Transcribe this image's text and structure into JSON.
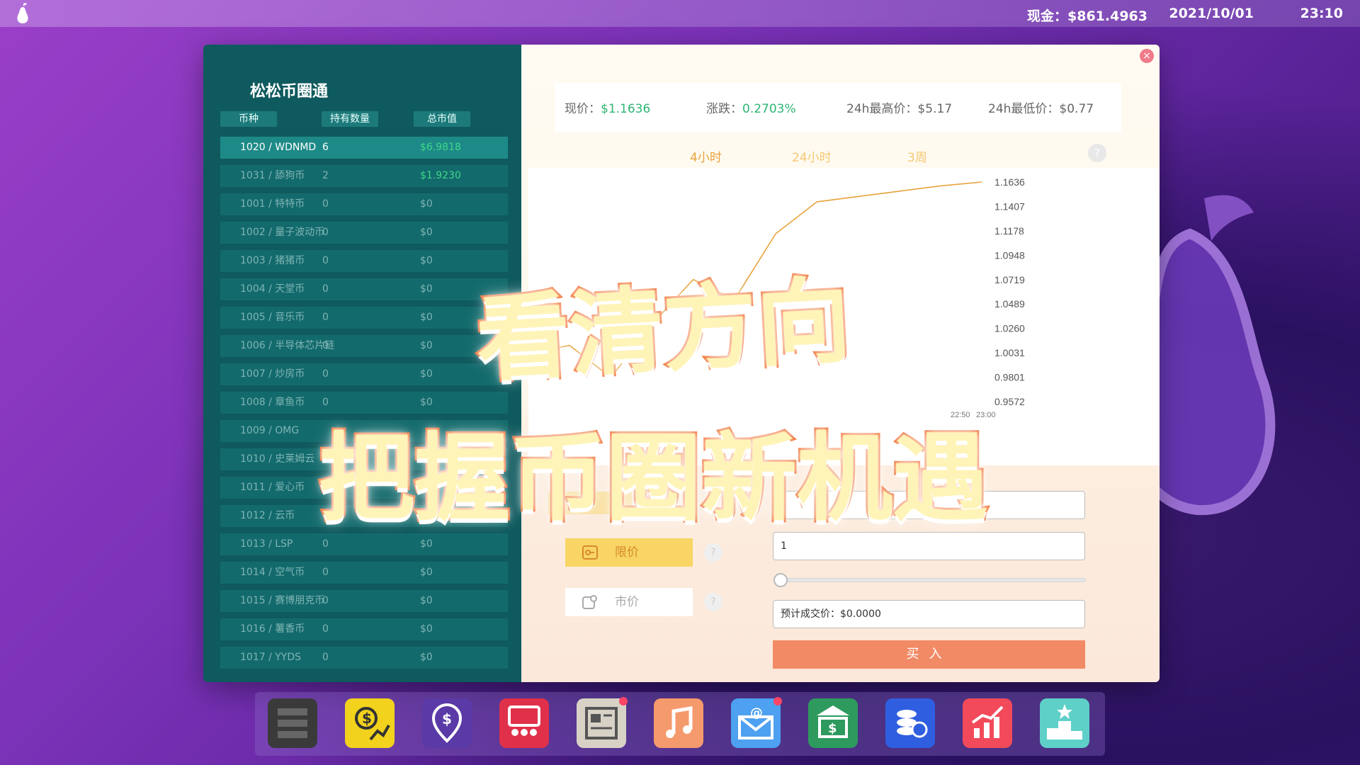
{
  "menubar": {
    "cash": "现金：$861.4963",
    "date": "2021/10/01",
    "time": "23:10"
  },
  "app": {
    "title": "松松币圈通",
    "columns": [
      "币种",
      "持有数量",
      "总市值"
    ],
    "coins": [
      {
        "name": "1020 / WDNMD",
        "qty": "6",
        "value": "$6.9818"
      },
      {
        "name": "1031 / 舔狗币",
        "qty": "2",
        "value": "$1.9230"
      },
      {
        "name": "1001 / 特特币",
        "qty": "0",
        "value": "$0"
      },
      {
        "name": "1002 / 量子波动币",
        "qty": "0",
        "value": "$0"
      },
      {
        "name": "1003 / 猪猪币",
        "qty": "0",
        "value": "$0"
      },
      {
        "name": "1004 / 天堂币",
        "qty": "0",
        "value": "$0"
      },
      {
        "name": "1005 / 音乐币",
        "qty": "0",
        "value": "$0"
      },
      {
        "name": "1006 / 半导体芯片链",
        "qty": "0",
        "value": "$0"
      },
      {
        "name": "1007 / 炒房币",
        "qty": "0",
        "value": "$0"
      },
      {
        "name": "1008 / 章鱼币",
        "qty": "0",
        "value": "$0"
      },
      {
        "name": "1009 / OMG",
        "qty": "",
        "value": ""
      },
      {
        "name": "1010 / 史莱姆云",
        "qty": "",
        "value": ""
      },
      {
        "name": "1011 / 爱心币",
        "qty": "",
        "value": ""
      },
      {
        "name": "1012 / 云币",
        "qty": "0",
        "value": "$0"
      },
      {
        "name": "1013 / LSP",
        "qty": "0",
        "value": "$0"
      },
      {
        "name": "1014 / 空气币",
        "qty": "0",
        "value": "$0"
      },
      {
        "name": "1015 / 赛博朋克币",
        "qty": "0",
        "value": "$0"
      },
      {
        "name": "1016 / 薯香币",
        "qty": "0",
        "value": "$0"
      },
      {
        "name": "1017 / YYDS",
        "qty": "0",
        "value": "$0"
      }
    ],
    "stats": {
      "price_label": "现价：",
      "price_value": "$1.1636",
      "change_label": "涨跌：",
      "change_value": "0.2703%",
      "high_label": "24h最高价：",
      "high_value": "$5.17",
      "low_label": "24h最低价：",
      "low_value": "$0.77"
    },
    "ranges": [
      "4小时",
      "24小时",
      "3周"
    ],
    "help_symbol": "?",
    "close_symbol": "×",
    "buy_tab_label": "入",
    "limit_label": "限价",
    "market_label": "市价",
    "amount_placeholder": "",
    "quantity_value": "1",
    "estimate_value": "预计成交价：$0.0000",
    "buy_label": "买入"
  },
  "chart_data": {
    "type": "line",
    "y_ticks": [
      "1.1636",
      "1.1407",
      "1.1178",
      "1.0948",
      "1.0719",
      "1.0489",
      "1.0260",
      "1.0031",
      "0.9801",
      "0.9572"
    ],
    "x_ticks_visible": [
      "22:50",
      "23:00"
    ],
    "ylim": [
      0.9572,
      1.1636
    ],
    "series": [
      {
        "values": [
          1.003,
          1.01,
          0.98,
          1.03,
          1.072,
          1.053,
          1.115,
          1.145,
          1.15,
          1.155,
          1.16,
          1.1636
        ]
      }
    ],
    "color": "#e8a23a"
  },
  "promo": {
    "line1": "看清方向",
    "line2": "把握币圈新机遇"
  },
  "dock": {
    "icons": [
      {
        "name": "server-icon",
        "color": "#3a3a3a"
      },
      {
        "name": "money-chart-icon",
        "color": "#f2d21c"
      },
      {
        "name": "dollar-pin-icon",
        "color": "#5a3aa6"
      },
      {
        "name": "community-icon",
        "color": "#e0304a"
      },
      {
        "name": "newspaper-icon",
        "color": "#d8d2c6"
      },
      {
        "name": "music-icon",
        "color": "#f59a6c"
      },
      {
        "name": "mail-icon",
        "color": "#4ea0f0"
      },
      {
        "name": "bank-icon",
        "color": "#2e9a5e"
      },
      {
        "name": "coins-icon",
        "color": "#2f5fe0"
      },
      {
        "name": "stats-icon",
        "color": "#f24a5a"
      },
      {
        "name": "ranking-icon",
        "color": "#5ed0c8"
      }
    ]
  }
}
